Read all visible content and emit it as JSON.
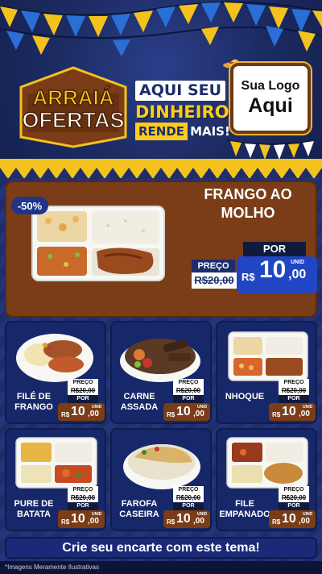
{
  "header": {
    "brand_line1": "ARRAIÁ",
    "brand_line2": "OFERTAS",
    "slogan_line1": "AQUI SEU",
    "slogan_line2": "DINHEIRO",
    "slogan_line3a": "RENDE",
    "slogan_line3b": "MAIS!",
    "logo_line1": "Sua Logo",
    "logo_line2": "Aqui"
  },
  "featured": {
    "discount": "-50%",
    "name_line1": "FRANGO AO",
    "name_line2": "MOLHO",
    "old_label": "PREÇO",
    "old_price": "R$20,00",
    "por_label": "POR",
    "currency": "R$",
    "price_int": "10",
    "price_dec": ",00",
    "unit": "UNID"
  },
  "products": [
    {
      "name_line1": "FILÉ DE",
      "name_line2": "FRANGO",
      "old_label": "PREÇO",
      "old_price": "R$20,00",
      "por_label": "POR",
      "currency": "R$",
      "price_int": "10",
      "price_dec": ",00",
      "unit": "UNID"
    },
    {
      "name_line1": "CARNE",
      "name_line2": "ASSADA",
      "old_label": "PREÇO",
      "old_price": "R$20,00",
      "por_label": "POR",
      "currency": "R$",
      "price_int": "10",
      "price_dec": ",00",
      "unit": "UNID"
    },
    {
      "name_line1": "NHOQUE",
      "name_line2": "",
      "old_label": "PREÇO",
      "old_price": "R$20,00",
      "por_label": "POR",
      "currency": "R$",
      "price_int": "10",
      "price_dec": ",00",
      "unit": "UNID"
    },
    {
      "name_line1": "PURE DE",
      "name_line2": "BATATA",
      "old_label": "PREÇO",
      "old_price": "R$20,00",
      "por_label": "POR",
      "currency": "R$",
      "price_int": "10",
      "price_dec": ",00",
      "unit": "UNID"
    },
    {
      "name_line1": "FAROFA",
      "name_line2": "CASEIRA",
      "old_label": "PREÇO",
      "old_price": "R$20,00",
      "por_label": "POR",
      "currency": "R$",
      "price_int": "10",
      "price_dec": ",00",
      "unit": "UNID"
    },
    {
      "name_line1": "FILE",
      "name_line2": "EMPANADO",
      "old_label": "PREÇO",
      "old_price": "R$20,00",
      "por_label": "POR",
      "currency": "R$",
      "price_int": "10",
      "price_dec": ",00",
      "unit": "UNID"
    }
  ],
  "footer": {
    "cta": "Crie seu encarte com este tema!",
    "disclaimer": "*Imagens Meramente Ilustrativas"
  },
  "colors": {
    "navy": "#1c2b62",
    "gold": "#f4c21d",
    "brown": "#7a3d17",
    "blue_price": "#2146c4"
  }
}
